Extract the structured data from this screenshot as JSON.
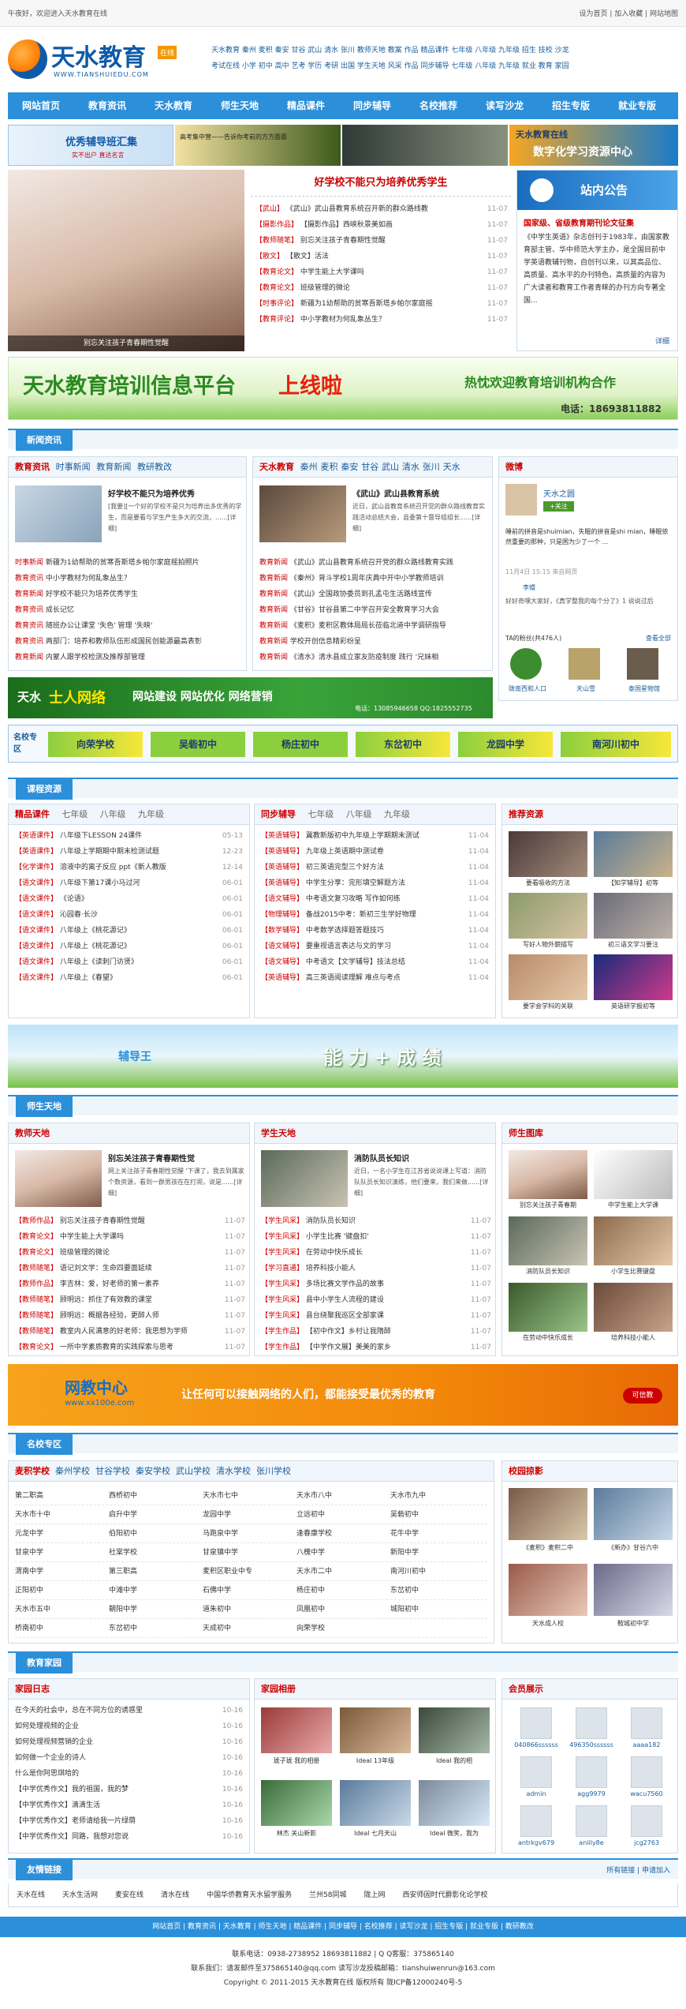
{
  "topbar": {
    "welcome": "午夜好，欢迎进入天水教育在线",
    "links": "设为首页 | 加入收藏 | 网站地图"
  },
  "logo": {
    "title": "天水教育",
    "badge": "在线",
    "domain": "WWW.TIANSHUIEDU.COM"
  },
  "head_links": [
    "天水教育 秦州 麦积 秦安 甘谷 武山 清水 张川   教师天地 教案 作品   精品课件 七年级 八年级 九年级   招生 技校 沙龙",
    "考试在线 小学 初中 高中 艺考 学历 考研 出国   学生天地 风采 作品   同步辅导 七年级 八年级 九年级   就业 教育 家园"
  ],
  "nav": [
    "网站首页",
    "教育资讯",
    "天水教育",
    "师生天地",
    "精品课件",
    "同步辅导",
    "名校推荐",
    "读写沙龙",
    "招生专版",
    "就业专版"
  ],
  "ad_row": {
    "a": "优秀辅导班汇集",
    "a2": "实不出户 直达名言",
    "b": "高考集中营——告诉你考前的方方面面",
    "c": "天水教育在线",
    "c2": "数字化学习资源中心"
  },
  "slider": {
    "caption": "别忘关注孩子青春期性觉醒"
  },
  "feature": {
    "title": "好学校不能只为培养优秀学生",
    "items": [
      {
        "tag": "【武山】",
        "text": "《武山》武山县教育系统召开新的群众路线教",
        "date": "11-07"
      },
      {
        "tag": "【摄影作品】",
        "text": "【摄影作品】西峡秋景美如画",
        "date": "11-07"
      },
      {
        "tag": "【教师随笔】",
        "text": "别忘关注孩子青春期性觉醒",
        "date": "11-07"
      },
      {
        "tag": "【散文】",
        "text": "【散文】活法",
        "date": "11-07"
      },
      {
        "tag": "【教育论文】",
        "text": "中学生能上大学课吗",
        "date": "11-07"
      },
      {
        "tag": "【教育论文】",
        "text": "班级管理的微论",
        "date": "11-07"
      },
      {
        "tag": "【时事评论】",
        "text": "新疆为1幼帮助的贫寒吾斯塔乡帕尔家庭摇",
        "date": "11-07"
      },
      {
        "tag": "【教育评论】",
        "text": "中小学教材为何乱象丛生？",
        "date": "11-07"
      }
    ]
  },
  "notice": {
    "title": "站内公告",
    "body": "国家级、省级教育期刊论文征集",
    "text": "《中学生英语》杂志创刊于1983年，由国家教育部主管、华中师范大学主办，是全国目前中学英语教辅刊物，自创刊以来，以其高品位、高质量、高水平的办刊特色，高质量的内容为广大读者和教育工作者青睐的办刊方向专著全国...",
    "more": "详细"
  },
  "training": {
    "left": "天水教育培训信息平台",
    "mid": "上线啦",
    "right": "热忱欢迎教育培训机构合作",
    "phone": "电话：18693811882"
  },
  "sections": {
    "news": "新闻资讯",
    "course": "课程资源",
    "teacher_student": "师生天地",
    "schools": "名校专区",
    "family": "教育家园",
    "links": "友情链接"
  },
  "news_left": {
    "tabs": [
      "教育资讯",
      "时事新闻",
      "教育新闻",
      "教研教改"
    ],
    "headline": "好学校不能只为培养优秀",
    "summary": "[我要][一个好的学校不是只为培养出多优秀的学生，而是要看与学生产生多大的交流，......[详细]",
    "items": [
      {
        "tag": "时事新闻",
        "text": "新疆为1幼帮助的贫寒吾斯塔乡帕尔家庭摇拍照片"
      },
      {
        "tag": "教育资讯",
        "text": "中小学教材为何乱象丛生？"
      },
      {
        "tag": "教育新闻",
        "text": "好学校不能只为培养优秀学生"
      },
      {
        "tag": "教育资讯",
        "text": "成长记忆"
      },
      {
        "tag": "教育资讯",
        "text": "随班办公让课堂 '失色' 管理 '失映'"
      },
      {
        "tag": "教育资讯",
        "text": "两部门：培养和教师队伍形成国民创能源最高表彰"
      },
      {
        "tag": "教育新闻",
        "text": "内蒙人跟学校检测及推荐部管理"
      }
    ]
  },
  "news_mid": {
    "tabs": [
      "天水教育",
      "秦州",
      "麦积",
      "秦安",
      "甘谷",
      "武山",
      "清水",
      "张川",
      "天水"
    ],
    "headline": "《武山》武山县教育系统",
    "summary": "近日，武山县教育系统召开党的群众路线教育实践活动总结大会，县委第十督导组组长......[详细]",
    "items": [
      {
        "tag": "教育新闻",
        "text": "《武山》武山县教育系统召开党的群众路线教育实践"
      },
      {
        "tag": "教育新闻",
        "text": "《秦州》背斗学校1周年庆典中开中小学教师培训"
      },
      {
        "tag": "教育新闻",
        "text": "《武山》全国政协委员到孔孟屯生活路线宣传"
      },
      {
        "tag": "教育新闻",
        "text": "《甘谷》甘谷县第二中学召开安全教育学习大会"
      },
      {
        "tag": "教育新闻",
        "text": "《麦积》麦积区教体局局长莅临北道中学调研指导"
      },
      {
        "tag": "教育新闻",
        "text": "学校开创信息精彩纷呈"
      },
      {
        "tag": "教育新闻",
        "text": "《清水》清水县成立家友防疫制度  践行 '兄妹相"
      }
    ]
  },
  "weibo": {
    "title": "微博",
    "name": "天水之圆",
    "follow": "+关注",
    "msg": "睡前的拼音是shuimian，失眠的拼音是shi mian，睡眠依然重要的那种，只是困为少了一个 ...",
    "time": "11月4日 15:15",
    "time_tail": "来自网页",
    "reply_name": "李嬛",
    "reply": "好好奇嘿大家好，《真学整我的每个分了》1 说说过后",
    "tags": "TA的粉丝(共476人)",
    "more": "查看全部",
    "fans": [
      "陇南西和人口",
      "天山雪",
      "泰国星物馆"
    ]
  },
  "net_banner": {
    "a": "天水",
    "b": "士人网络",
    "c": "网站建设 网站优化 网络营销",
    "d": "电话：13085946658  QQ:1825552735"
  },
  "school_strip": {
    "label": "名校专区",
    "schools": [
      "向荣学校",
      "吴砦初中",
      "杨庄初中",
      "东岔初中",
      "龙园中学",
      "南河川初中"
    ]
  },
  "course_left": {
    "tabs": [
      "精品课件",
      "七年级",
      "八年级",
      "九年级"
    ],
    "items": [
      {
        "tag": "【英语课件】",
        "text": "八年级下LESSON 24课件",
        "date": "05-13"
      },
      {
        "tag": "【英语课件】",
        "text": "八年级上学期期中期末检测试题",
        "date": "12-23"
      },
      {
        "tag": "【化学课件】",
        "text": "溶液中的离子反应 ppt《新人教版",
        "date": "12-14"
      },
      {
        "tag": "【语文课件】",
        "text": "八年级下第17课小马过河",
        "date": "06-01"
      },
      {
        "tag": "【语文课件】",
        "text": "《论语》",
        "date": "06-01"
      },
      {
        "tag": "【语文课件】",
        "text": "沁园春·长沙",
        "date": "06-01"
      },
      {
        "tag": "【语文课件】",
        "text": "八年级上《桃花源记》",
        "date": "06-01"
      },
      {
        "tag": "【语文课件】",
        "text": "八年级上《桃花源记》",
        "date": "06-01"
      },
      {
        "tag": "【语文课件】",
        "text": "八年级上《读刺门访贤》",
        "date": "06-01"
      },
      {
        "tag": "【语文课件】",
        "text": "八年级上《春望》",
        "date": "06-01"
      }
    ]
  },
  "course_mid": {
    "tabs": [
      "同步辅导",
      "七年级",
      "八年级",
      "九年级"
    ],
    "items": [
      {
        "tag": "【英语辅导】",
        "text": "冀教新版初中九年级上学期期末测试",
        "date": "11-04"
      },
      {
        "tag": "【英语辅导】",
        "text": "九年级上英语期中测试卷",
        "date": "11-04"
      },
      {
        "tag": "【英语辅导】",
        "text": "初三英语完型三个好方法",
        "date": "11-04"
      },
      {
        "tag": "【英语辅导】",
        "text": "中学生分享：完形填空解题方法",
        "date": "11-04"
      },
      {
        "tag": "【语文辅导】",
        "text": "中考语文复习攻略 写作如何练",
        "date": "11-04"
      },
      {
        "tag": "【物理辅导】",
        "text": "备战2015中考：新初三生学好物理",
        "date": "11-04"
      },
      {
        "tag": "【数学辅导】",
        "text": "中考数学选择题答题技巧",
        "date": "11-04"
      },
      {
        "tag": "【语文辅导】",
        "text": "要重视语言表达与文的学习",
        "date": "11-04"
      },
      {
        "tag": "【语文辅导】",
        "text": "中考语文【文学辅导】技法总结",
        "date": "11-04"
      },
      {
        "tag": "【英语辅导】",
        "text": "高三英语阅读理解 难点与考点",
        "date": "11-04"
      }
    ]
  },
  "recommend": {
    "title": "推荐资源",
    "items": [
      "要看吸收的方法",
      "【知学辅导】初等",
      "写好人物外貌描写",
      "初三语文学习要注",
      "要学会学科的关联",
      "英语研学报初等"
    ]
  },
  "ability_banner": {
    "a": "辅导王",
    "b": "能 力 + 成 绩"
  },
  "teacher": {
    "title": "教师天地",
    "headline": "别忘关注孩子青春期性觉",
    "summary": "网上关注孩子青春期性觉醒 '下课了，我去到属家个数资源，看到一群男孩在在打闹，说是......[详细]",
    "items": [
      {
        "tag": "【教师作品】",
        "text": "别忘关注孩子青春期性觉醒",
        "date": "11-07"
      },
      {
        "tag": "【教育论文】",
        "text": "中学生能上大学课吗",
        "date": "11-07"
      },
      {
        "tag": "【教育论文】",
        "text": "班级管理的微论",
        "date": "11-07"
      },
      {
        "tag": "【教师随笔】",
        "text": "语记刘文学：生命四要面延续",
        "date": "11-07"
      },
      {
        "tag": "【教师作品】",
        "text": "李吉林：爱，好老师的第一素养",
        "date": "11-07"
      },
      {
        "tag": "【教师随笔】",
        "text": "顾明远：抓住了有效教的课堂",
        "date": "11-07"
      },
      {
        "tag": "【教师随笔】",
        "text": "顾明远：概据各经验，更醉人师",
        "date": "11-07"
      },
      {
        "tag": "【教师随笔】",
        "text": "教室内人民满意的好老师：我思想为学师",
        "date": "11-07"
      },
      {
        "tag": "【教育论文】",
        "text": "一所中学素质教育的实践探索与思考",
        "date": "11-07"
      }
    ]
  },
  "student": {
    "title": "学生天地",
    "headline": "消防队员长知识",
    "summary": "近日，一名小学生在江苏省说说课上写道：消防队队员长知识演练，他们要来，我们来做......[详细]",
    "items": [
      {
        "tag": "【学生风采】",
        "text": "消防队员长知识",
        "date": "11-07"
      },
      {
        "tag": "【学生风采】",
        "text": "小学生比赛 '键盘扣'",
        "date": "11-07"
      },
      {
        "tag": "【学生风采】",
        "text": "在劳动中快乐成长",
        "date": "11-07"
      },
      {
        "tag": "【学习直通】",
        "text": "培养科技小能人",
        "date": "11-07"
      },
      {
        "tag": "【学生风采】",
        "text": "多场比赛文学作品的故事",
        "date": "11-07"
      },
      {
        "tag": "【学生风采】",
        "text": "县中小学生人流程的建设",
        "date": "11-07"
      },
      {
        "tag": "【学生风采】",
        "text": "县台绕聚我巡区全部家课",
        "date": "11-07"
      },
      {
        "tag": "【学生作品】",
        "text": "【初中作文】乡村让我隋醉",
        "date": "11-07"
      },
      {
        "tag": "【学生作品】",
        "text": "【中学作文展】美美的家乡",
        "date": "11-07"
      }
    ]
  },
  "ts_photos": {
    "title": "师生图库",
    "items": [
      "别忘关注孩子青春期",
      "中学生能上大学课",
      "消防队员长知识",
      "小学生比赛键盘",
      "在劳动中快乐成长",
      "培养科技小能人"
    ]
  },
  "edu_banner": {
    "a": "网教中心",
    "b": "www.xx100e.com",
    "c": "让任何可以接触网络的人们，都能接受最优秀的教育",
    "d": "可信教"
  },
  "schools": {
    "tabs": [
      "麦积学校",
      "秦州学校",
      "甘谷学校",
      "秦安学校",
      "武山学校",
      "清水学校",
      "张川学校"
    ],
    "rows": [
      [
        "第二职高",
        "西桥初中",
        "天水市七中",
        "天水市八中",
        "天水市九中"
      ],
      [
        "天水市十中",
        "启升中学",
        "龙园中学",
        "立远初中",
        "吴砦初中"
      ],
      [
        "元龙中学",
        "伯阳初中",
        "马跑泉中学",
        "逢春康学校",
        "花牛中学"
      ],
      [
        "甘泉中学",
        "社棠学校",
        "甘泉镇中学",
        "八槐中学",
        "新阳中学"
      ],
      [
        "渭南中学",
        "第三职高",
        "麦积区职业中专",
        "天水市二中",
        "南河川初中"
      ],
      [
        "正阳初中",
        "中滩中学",
        "石佛中学",
        "杨庄初中",
        "东岔初中"
      ],
      [
        "天水市五中",
        "朝阳中学",
        "道朱初中",
        "凤凰初中",
        "城阳初中"
      ],
      [
        "桥南初中",
        "东岔初中",
        "天成初中",
        "向荣学校",
        ""
      ]
    ]
  },
  "campus_photos": {
    "title": "校园掠影",
    "items": [
      "《麦积》麦积二中",
      "《新办》甘谷六中",
      "天水成人校",
      "鞍城初中学"
    ]
  },
  "family_diary": {
    "title": "家园日志",
    "items": [
      {
        "text": "在今天的社会中，总在不同方位的诱惑里",
        "date": "10-16"
      },
      {
        "text": "如何处理视频的企业",
        "date": "10-16"
      },
      {
        "text": "如何处理视频营销的企业",
        "date": "10-16"
      },
      {
        "text": "如何做一个企业的诗人",
        "date": "10-16"
      },
      {
        "text": "什么是你阿思琪哈的",
        "date": "10-16"
      },
      {
        "text": "【中学优秀作文】我的祖国，我的梦",
        "date": "10-16"
      },
      {
        "text": "【中学优秀作文】滴滴生活",
        "date": "10-16"
      },
      {
        "text": "【中学优秀作文】老师请给我一片绿荫",
        "date": "10-16"
      },
      {
        "text": "【中学优秀作文】同路，我想对您说",
        "date": "10-16"
      }
    ]
  },
  "family_album": {
    "title": "家园相册",
    "items": [
      "琥子琥  我的相册",
      "Ideal 13年级",
      "Ideal 我的相",
      "林杰 关山新影",
      "Ideal 七月天山",
      "Ideal 微笑，我为"
    ]
  },
  "members": {
    "title": "会员展示",
    "names": [
      "040866ssssss",
      "496350ssssss",
      "aaaa182",
      "admin",
      "agg9979",
      "wacu7560",
      "antrkgv679",
      "aniily8e",
      "jcg2763"
    ]
  },
  "friend_links": {
    "more": "所有链接 | 申请加入",
    "items": [
      "天水在线",
      "天水生活网",
      "麦安在线",
      "清水在线",
      "中国华侨教育天水留学服务",
      "兰州58同城",
      "陇上网",
      "西安师固时代爵影化论学校"
    ]
  },
  "footer": {
    "nav": "网站首页 | 教育资讯 | 天水教育 | 师生天地 | 精品课件 | 同步辅导 | 名校推荐 | 读写沙龙 | 招生专版 | 就业专版 | 教研教改",
    "line1": "联系电话：0938-2738952  18693811882  | Q Q客服：375865140",
    "line2": "联系我们：请发邮件至375865140@qq.com 读写沙龙投稿邮箱：tianshuiwenrun@163.com",
    "line3": "Copyright © 2011-2015  天水教育在线  版权所有  陇ICP备12000240号-5"
  },
  "colors": {
    "nav": "#2c8fd9",
    "title_red": "#cc0000",
    "link_blue": "#1a5d9c"
  }
}
